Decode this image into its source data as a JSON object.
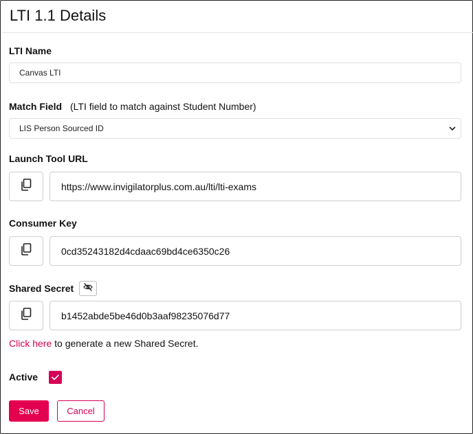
{
  "page": {
    "title": "LTI 1.1 Details"
  },
  "lti_name": {
    "label": "LTI Name",
    "value": "Canvas LTI"
  },
  "match_field": {
    "label": "Match Field",
    "hint": "(LTI field to match against Student Number)",
    "selected": "LIS Person Sourced ID",
    "icon": "chevron-down-icon"
  },
  "launch_url": {
    "label": "Launch Tool URL",
    "value": "https://www.invigilatorplus.com.au/lti/lti-exams",
    "copy_icon": "copy-icon"
  },
  "consumer_key": {
    "label": "Consumer Key",
    "value": "0cd35243182d4cdaac69bd4ce6350c26",
    "copy_icon": "copy-icon"
  },
  "shared_secret": {
    "label": "Shared Secret",
    "value": "b1452abde5be46d0b3aaf98235076d77",
    "copy_icon": "copy-icon",
    "toggle_icon": "eye-slash-icon"
  },
  "generate": {
    "link": "Click here",
    "rest": " to generate a new Shared Secret."
  },
  "active": {
    "label": "Active",
    "checked": true
  },
  "actions": {
    "save": "Save",
    "cancel": "Cancel"
  },
  "colors": {
    "accent": "#e3004f",
    "link": "#d50057",
    "border": "#cfcfcf"
  }
}
